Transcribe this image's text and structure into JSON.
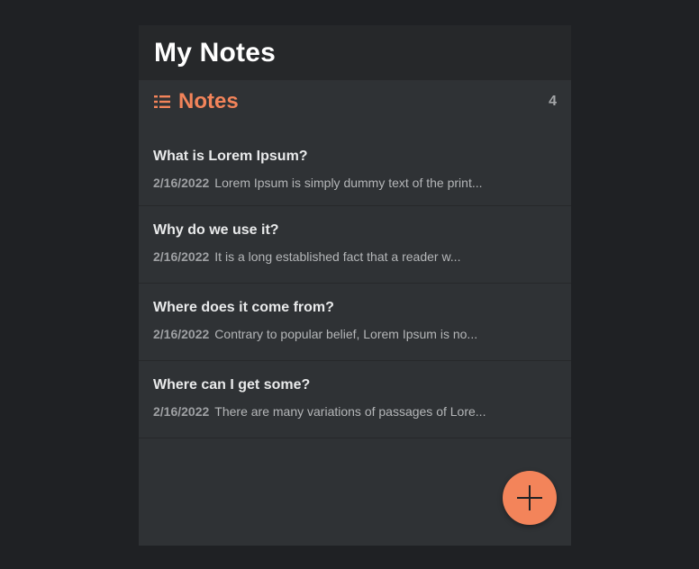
{
  "app": {
    "title": "My Notes"
  },
  "notes_section": {
    "icon": "list-icon",
    "label": "Notes",
    "count": "4"
  },
  "notes": [
    {
      "title": "What is Lorem Ipsum?",
      "date": "2/16/2022",
      "preview": "Lorem Ipsum is simply dummy text of the print..."
    },
    {
      "title": "Why do we use it?",
      "date": "2/16/2022",
      "preview": "It is a long established fact that a reader w..."
    },
    {
      "title": "Where does it come from?",
      "date": "2/16/2022",
      "preview": "Contrary to popular belief, Lorem Ipsum is no..."
    },
    {
      "title": "Where can I get some?",
      "date": "2/16/2022",
      "preview": "There are many variations of passages of Lore..."
    }
  ],
  "add_button": {
    "icon": "plus-icon"
  },
  "colors": {
    "accent": "#f3845a",
    "page_background": "#1f2124",
    "panel_background": "#2f3235",
    "header_background": "#26282a"
  }
}
